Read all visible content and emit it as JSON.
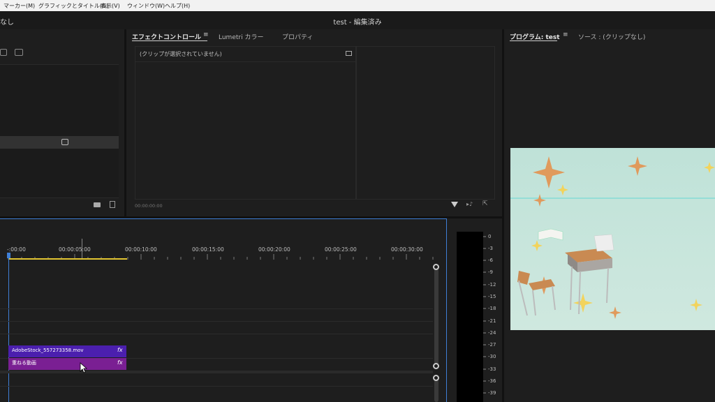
{
  "menu": [
    "マーカー(M)",
    "グラフィックとタイトル(G)",
    "表示(V)",
    "ウィンドウ(W)",
    "ヘルプ(H)"
  ],
  "window": {
    "title": "test - 編集済み",
    "left_fragment": "なし"
  },
  "effect_panel": {
    "tabs": [
      "エフェクトコントロール",
      "Lumetri カラー",
      "プロパティ"
    ],
    "empty_message": "(クリップが選択されていません)",
    "timecode": "00:00:00:00"
  },
  "program_panel": {
    "tabs": [
      "プログラム: test",
      "ソース : (クリップなし)"
    ]
  },
  "timeline": {
    "ruler": [
      "-:00:00",
      "00:00:05:00",
      "00:00:10:00",
      "00:00:15:00",
      "00:00:20:00",
      "00:00:25:00",
      "00:00:30:00"
    ],
    "clips": [
      {
        "label": "AdobeStock_557273358.mov",
        "fx": "fx",
        "color": "#4b1fae"
      },
      {
        "label": "重ねる動画",
        "fx": "fx",
        "color": "#7a1f93"
      }
    ]
  },
  "audio_meter": [
    "0",
    "-3",
    "-6",
    "-9",
    "-12",
    "-15",
    "-18",
    "-21",
    "-24",
    "-27",
    "-30",
    "-33",
    "-36",
    "-39"
  ],
  "colors": {
    "accent": "#3f7fd6",
    "playhead_in": "#e2c531",
    "preview_bg": "#bfe2d8"
  }
}
